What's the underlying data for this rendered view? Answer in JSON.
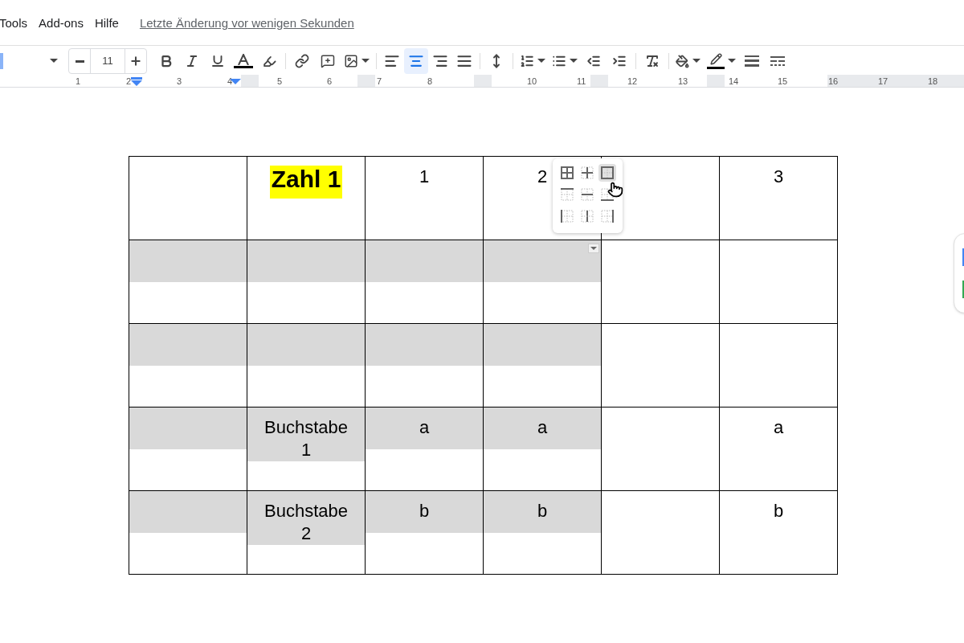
{
  "menu": [
    {
      "label": "Tools"
    },
    {
      "label": "Add-ons"
    },
    {
      "label": "Hilfe"
    }
  ],
  "last_edit": "Letzte Änderung vor wenigen Sekunden",
  "toolbar": {
    "font_size": "11",
    "alignment": [
      {
        "kind": "left",
        "selected": false
      },
      {
        "kind": "center",
        "selected": true
      },
      {
        "kind": "right",
        "selected": false
      },
      {
        "kind": "justify",
        "selected": false
      }
    ]
  },
  "ruler": {
    "numbers": [
      "1",
      "2",
      "3",
      "4",
      "5",
      "6",
      "7",
      "8",
      "10",
      "11",
      "12",
      "13",
      "14",
      "15",
      "16",
      "17",
      "18"
    ]
  },
  "table": {
    "rows": [
      [
        {
          "text": "",
          "shaded": false
        },
        {
          "text": "Zahl 1",
          "shaded": false,
          "bold": true,
          "highlighted": true
        },
        {
          "text": "1",
          "shaded": false
        },
        {
          "text": "2",
          "shaded": false
        },
        {
          "text": "",
          "shaded": false
        },
        {
          "text": "3",
          "shaded": false
        }
      ],
      [
        {
          "text": "",
          "shaded": true
        },
        {
          "text": "",
          "shaded": true
        },
        {
          "text": "",
          "shaded": true
        },
        {
          "text": "",
          "shaded": true,
          "menu_arrow": true
        },
        {
          "text": "",
          "shaded": false
        },
        {
          "text": "",
          "shaded": false
        }
      ],
      [
        {
          "text": "",
          "shaded": true
        },
        {
          "text": "",
          "shaded": true
        },
        {
          "text": "",
          "shaded": true
        },
        {
          "text": "",
          "shaded": true
        },
        {
          "text": "",
          "shaded": false
        },
        {
          "text": "",
          "shaded": false
        }
      ],
      [
        {
          "text": "",
          "shaded": true
        },
        {
          "text": "Buchstabe 1",
          "shaded": true
        },
        {
          "text": "a",
          "shaded": true
        },
        {
          "text": "a",
          "shaded": true
        },
        {
          "text": "",
          "shaded": false
        },
        {
          "text": "a",
          "shaded": false
        }
      ],
      [
        {
          "text": "",
          "shaded": true
        },
        {
          "text": "Buchstabe 2",
          "shaded": true
        },
        {
          "text": "b",
          "shaded": true
        },
        {
          "text": "b",
          "shaded": true
        },
        {
          "text": "",
          "shaded": false
        },
        {
          "text": "b",
          "shaded": false
        }
      ]
    ]
  },
  "border_menu": {
    "items": [
      {
        "kind": "all",
        "selected": false
      },
      {
        "kind": "inner",
        "selected": false
      },
      {
        "kind": "outer",
        "selected": true
      },
      {
        "kind": "top",
        "selected": false
      },
      {
        "kind": "horizontal",
        "selected": false
      },
      {
        "kind": "bottom",
        "selected": false
      },
      {
        "kind": "left",
        "selected": false
      },
      {
        "kind": "vertical",
        "selected": false
      },
      {
        "kind": "right",
        "selected": false
      }
    ]
  }
}
